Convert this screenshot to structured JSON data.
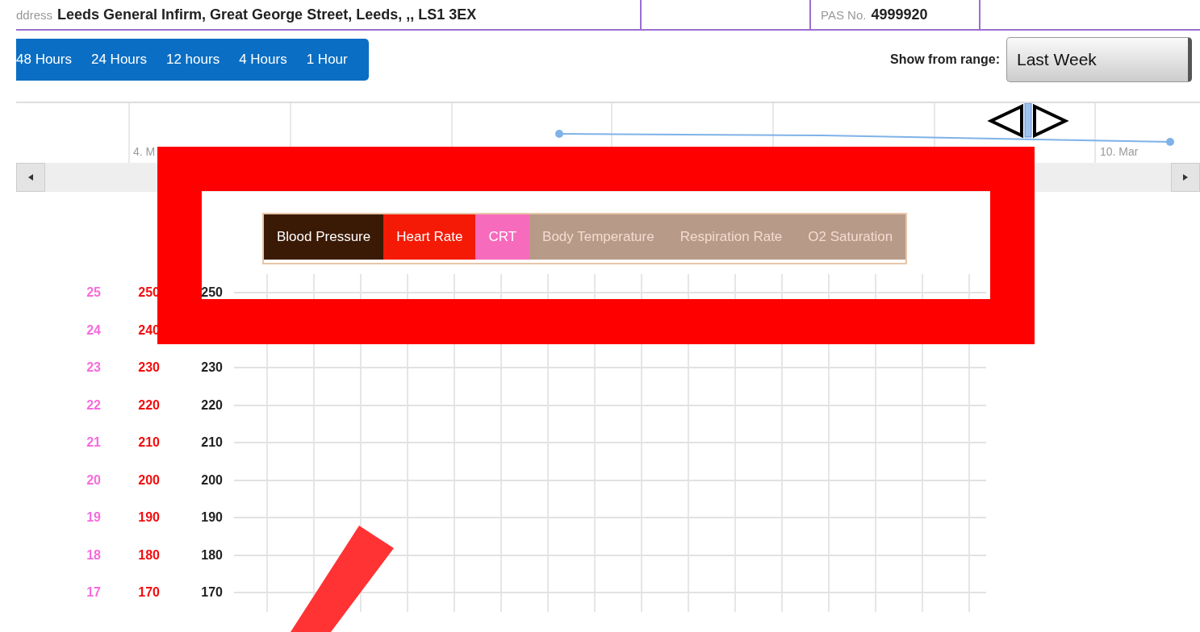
{
  "patient": {
    "address_label": "ddress",
    "address": "Leeds General Infirm, Great George Street, Leeds, ,, LS1 3EX",
    "pas_label": "PAS No.",
    "pas_number": "4999920"
  },
  "range_buttons": [
    {
      "label": "48 Hours"
    },
    {
      "label": "24 Hours"
    },
    {
      "label": "12 hours"
    },
    {
      "label": "4 Hours"
    },
    {
      "label": "1 Hour"
    }
  ],
  "range_select": {
    "label": "Show from range:",
    "value": "Last Week"
  },
  "navigator": {
    "date_labels": [
      "4. M",
      "10. Mar"
    ]
  },
  "series_tabs": [
    {
      "label": "Blood Pressure",
      "color": "#3a1a05",
      "active": true
    },
    {
      "label": "Heart Rate",
      "color": "#f41a05",
      "active": true
    },
    {
      "label": "CRT",
      "color": "#f76bbd",
      "active": true
    },
    {
      "label": "Body Temperature",
      "color": "#b89a88",
      "active": false
    },
    {
      "label": "Respiration Rate",
      "color": "#b89a88",
      "active": false
    },
    {
      "label": "O2 Saturation",
      "color": "#b89a88",
      "active": false
    }
  ],
  "axis_rows": [
    {
      "crt": "25",
      "heart_rate": "250",
      "blood_pressure": "250"
    },
    {
      "crt": "24",
      "heart_rate": "240"
    },
    {
      "crt": "23",
      "heart_rate": "230",
      "blood_pressure": "230"
    },
    {
      "crt": "22",
      "heart_rate": "220",
      "blood_pressure": "220"
    },
    {
      "crt": "21",
      "heart_rate": "210",
      "blood_pressure": "210"
    },
    {
      "crt": "20",
      "heart_rate": "200",
      "blood_pressure": "200"
    },
    {
      "crt": "19",
      "heart_rate": "190",
      "blood_pressure": "190"
    },
    {
      "crt": "18",
      "heart_rate": "180",
      "blood_pressure": "180"
    },
    {
      "crt": "17",
      "heart_rate": "170",
      "blood_pressure": "170"
    }
  ]
}
